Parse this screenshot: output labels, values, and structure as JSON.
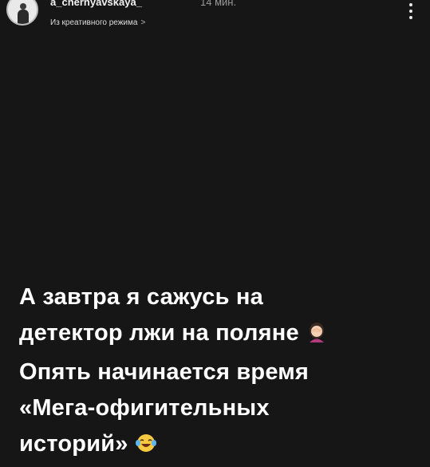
{
  "header": {
    "username": "a_chernyavskaya_",
    "time": "14 мин.",
    "subtitle": "Из креативного режима",
    "subtitle_chevron": ">",
    "more_icon": "more-vertical-icon"
  },
  "story": {
    "lines": [
      "А завтра я сажусь на",
      "детектор лжи на поляне",
      "Опять начинается время",
      "«Мега-офигительных",
      "историй»"
    ],
    "emoji_1": "woman-facepalming-emoji",
    "emoji_2": "face-with-tears-of-joy-emoji"
  },
  "colors": {
    "background": "#161616",
    "text": "#ffffff",
    "muted": "#9a9a9a"
  }
}
